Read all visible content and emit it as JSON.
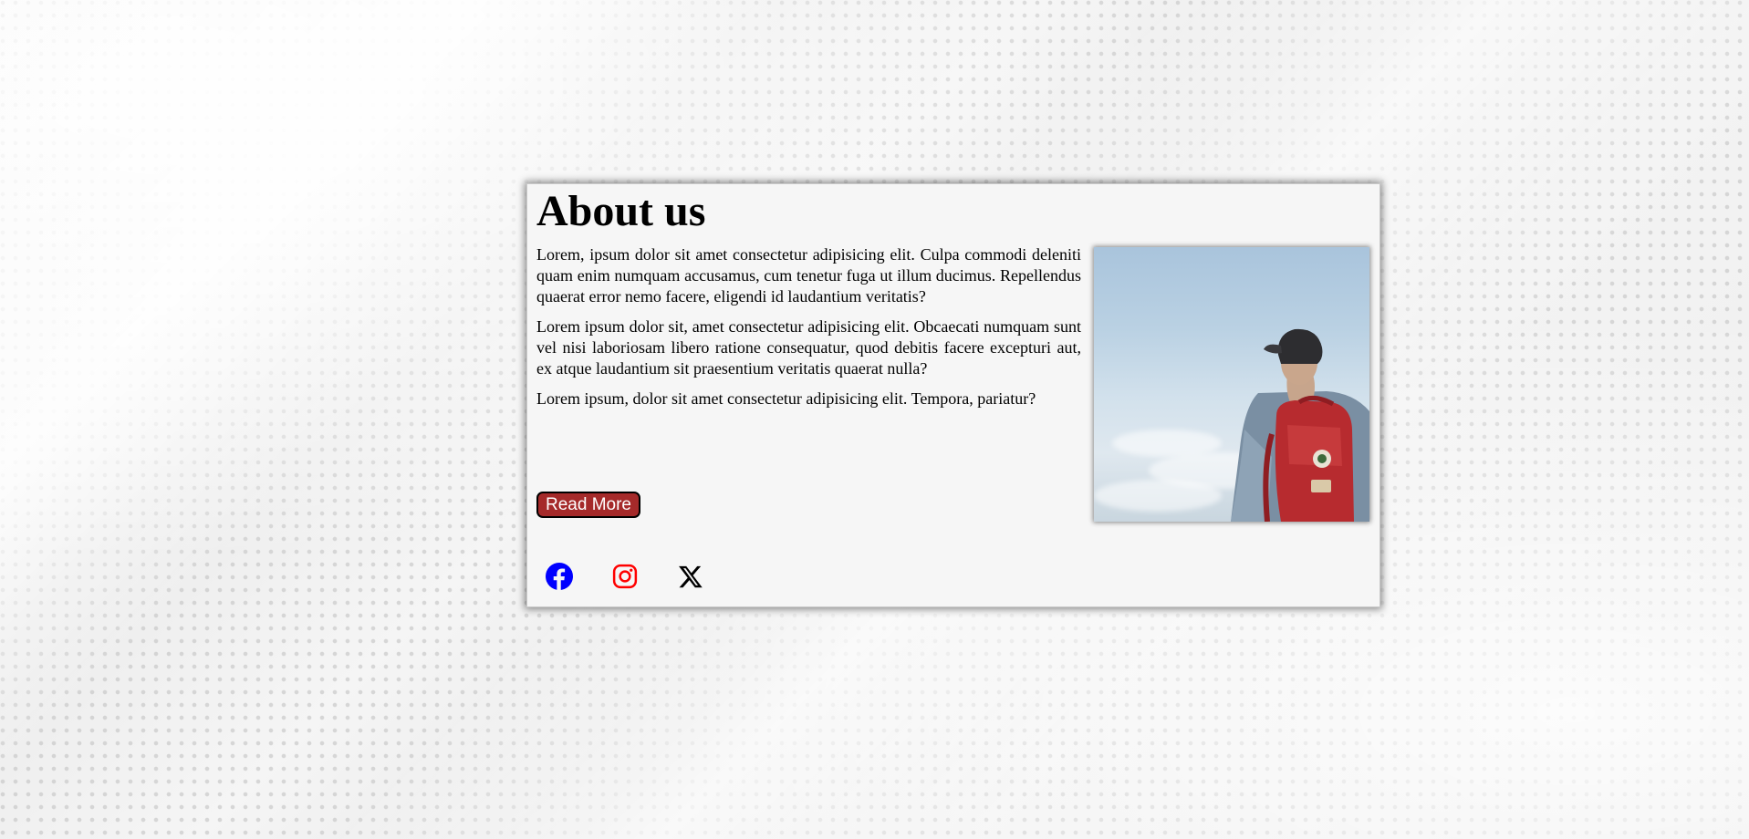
{
  "about": {
    "title": "About us",
    "paragraphs": [
      "Lorem, ipsum dolor sit amet consectetur adipisicing elit. Culpa commodi deleniti quam enim numquam accusamus, cum tenetur fuga ut illum ducimus. Repellendus quaerat error nemo facere, eligendi id laudantium veritatis?",
      "Lorem ipsum dolor sit, amet consectetur adipisicing elit. Obcaecati numquam sunt vel nisi laboriosam libero ratione consequatur, quod debitis facere excepturi aut, ex atque laudantium sit praesentium veritatis quaerat nulla?",
      "Lorem ipsum, dolor sit amet consectetur adipisicing elit. Tempora, pariatur?"
    ],
    "read_more_label": "Read More"
  },
  "image": {
    "subject": "person-with-red-backpack-under-sky"
  },
  "social": [
    {
      "icon": "facebook-icon",
      "color": "#0000ff"
    },
    {
      "icon": "instagram-icon",
      "color": "#ff0000"
    },
    {
      "icon": "x-twitter-icon",
      "color": "#000000"
    }
  ],
  "colors": {
    "button_bg": "#a52a2a",
    "card_bg": "#f6f6f6"
  }
}
